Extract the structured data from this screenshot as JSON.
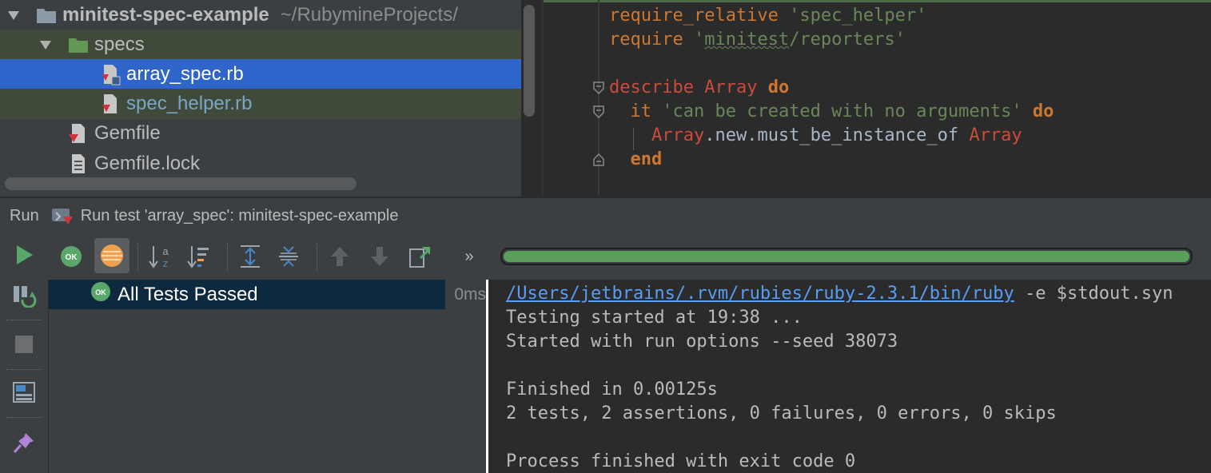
{
  "project_tree": {
    "root": {
      "name": "minitest-spec-example",
      "path": "~/RubymineProjects/"
    },
    "items": [
      {
        "label": "specs",
        "type": "folder"
      },
      {
        "label": "array_spec.rb",
        "type": "ruby-test-file",
        "selected": true
      },
      {
        "label": "spec_helper.rb",
        "type": "ruby-file"
      },
      {
        "label": "Gemfile",
        "type": "gemfile"
      },
      {
        "label": "Gemfile.lock",
        "type": "text-file"
      }
    ]
  },
  "editor": {
    "lines": [
      {
        "parts": [
          {
            "t": "require_relative",
            "c": "kw2"
          },
          {
            "t": " "
          },
          {
            "t": "'spec_helper'",
            "c": "str"
          }
        ]
      },
      {
        "parts": [
          {
            "t": "require",
            "c": "kw2"
          },
          {
            "t": " "
          },
          {
            "t": "'",
            "c": "str"
          },
          {
            "t": "minitest",
            "c": "str squiggle"
          },
          {
            "t": "/reporters'",
            "c": "str"
          }
        ]
      },
      {
        "parts": []
      },
      {
        "parts": [
          {
            "t": "describe",
            "c": "cls"
          },
          {
            "t": " "
          },
          {
            "t": "Array",
            "c": "cls"
          },
          {
            "t": " "
          },
          {
            "t": "do",
            "c": "kw"
          }
        ]
      },
      {
        "parts": [
          {
            "t": "  "
          },
          {
            "t": "it",
            "c": "kw2"
          },
          {
            "t": " "
          },
          {
            "t": "'can be created with no arguments'",
            "c": "str"
          },
          {
            "t": " "
          },
          {
            "t": "do",
            "c": "kw"
          }
        ]
      },
      {
        "parts": [
          {
            "t": "    "
          },
          {
            "t": "Array",
            "c": "cls"
          },
          {
            "t": ".new.must_be_instance_of",
            "c": "meth"
          },
          {
            "t": " "
          },
          {
            "t": "Array",
            "c": "cls"
          }
        ]
      },
      {
        "parts": [
          {
            "t": "  "
          },
          {
            "t": "end",
            "c": "kw"
          }
        ]
      }
    ]
  },
  "run_panel": {
    "label": "Run",
    "tab_title": "Run test 'array_spec': minitest-spec-example",
    "more_label": "»",
    "progress_fraction": 1.0
  },
  "test_tree": {
    "status": "All Tests Passed",
    "ok_badge": "OK",
    "duration": "0ms"
  },
  "console": {
    "command_path": "/Users/jetbrains/.rvm/rubies/ruby-2.3.1/bin/ruby",
    "command_rest": " -e $stdout.syn",
    "lines": [
      "Testing started at 19:38 ...",
      "Started with run options --seed 38073",
      "",
      "Finished in 0.00125s",
      "2 tests, 2 assertions, 0 failures, 0 errors, 0 skips",
      "",
      "Process finished with exit code 0"
    ]
  },
  "colors": {
    "selection": "#2f65ca",
    "progress": "#5a9e5a",
    "keyword": "#cc7832",
    "string": "#6a8759",
    "link": "#589df6"
  }
}
